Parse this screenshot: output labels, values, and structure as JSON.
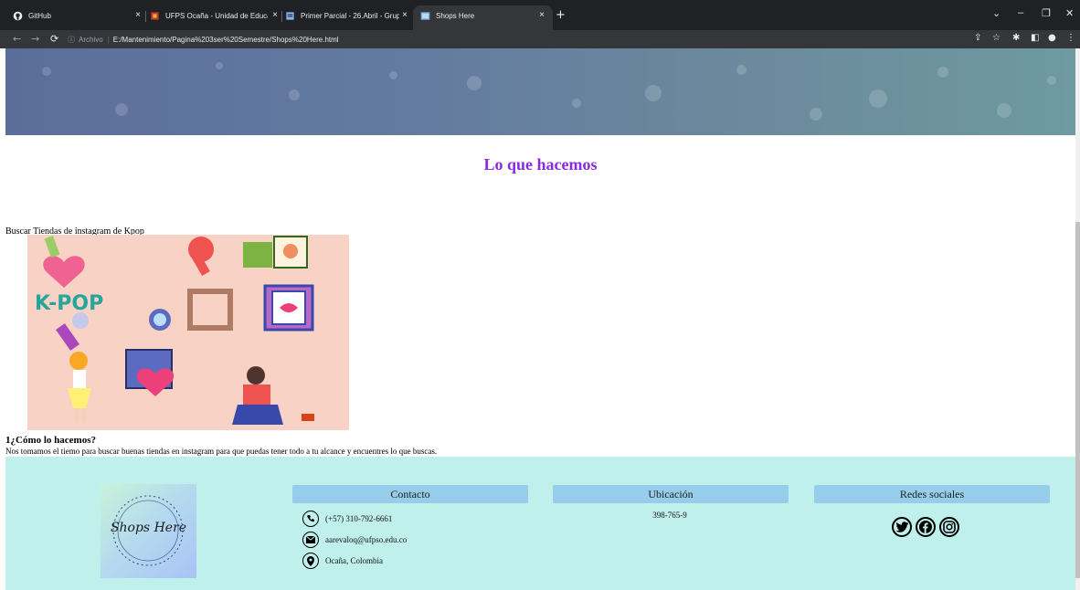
{
  "browser": {
    "tabs": [
      {
        "label": "GitHub",
        "close": "×"
      },
      {
        "label": "UFPS Ocaña - Unidad de Educac",
        "close": "×"
      },
      {
        "label": "Primer Parcial - 26.Abril - Grupo",
        "close": "×"
      },
      {
        "label": "Shops Here",
        "close": "×",
        "active": true
      }
    ],
    "new_tab": "+",
    "address": {
      "scheme_label": "Archivo",
      "url": "E:/Mantenimiento/Pagina%203ser%20Semestre/Shops%20Here.html"
    },
    "window_controls": [
      "⌄",
      "–",
      "❐",
      "✕"
    ]
  },
  "page": {
    "section_title": "Lo que hacemos",
    "search_caption": "Buscar Tiendas de instagram de Kpop",
    "image_text": "K-POP",
    "how_title": "1¿Cómo lo hacemos?",
    "how_text": "Nos tomamos el tiemo para buscar buenas tiendas en instagram para que puedas tener todo a tu alcance y encuentres lo que buscas."
  },
  "footer": {
    "logo_text": "Shops Here",
    "contact": {
      "heading": "Contacto",
      "phone": "(+57) 310-792-6661",
      "email": "aarevaloq@ufpso.edu.co",
      "location": "Ocaña, Colombia"
    },
    "location": {
      "heading": "Ubicación",
      "value": "398-765-9"
    },
    "social": {
      "heading": "Redes sociales",
      "networks": [
        "twitter",
        "facebook",
        "instagram"
      ]
    }
  },
  "colors": {
    "title_purple": "#8a2be2",
    "footer_bg": "#bff0ec",
    "footer_heading_bg": "#95cdea",
    "kpop_bg": "#f8d2c4"
  }
}
